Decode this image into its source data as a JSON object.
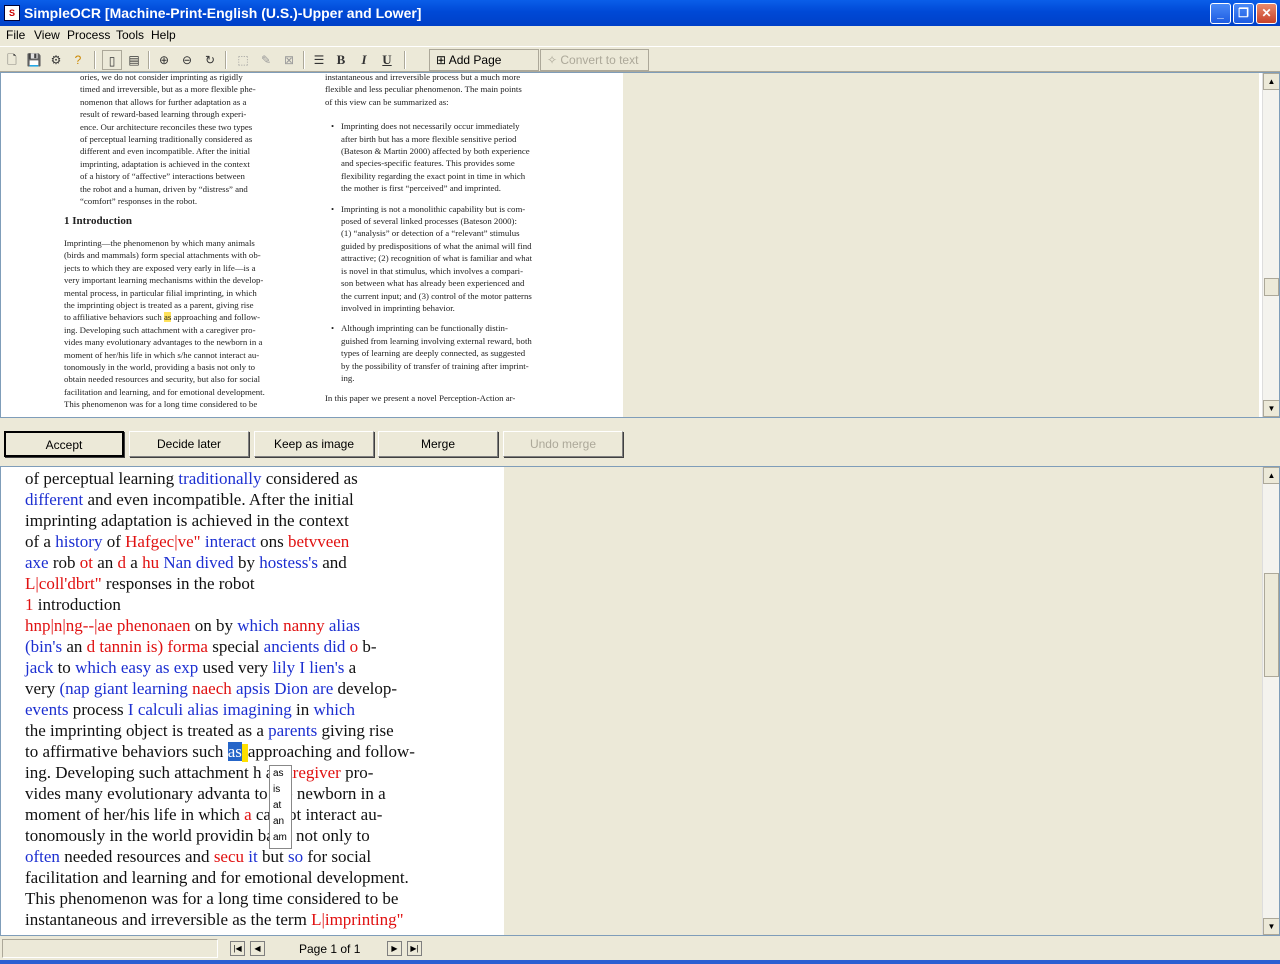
{
  "window": {
    "title": "SimpleOCR [Machine-Print-English (U.S.)-Upper and Lower]",
    "app_icon": "ocr-app-icon"
  },
  "menu": [
    "File",
    "View",
    "Process",
    "Tools",
    "Help"
  ],
  "toolbar": {
    "add_page": "Add Page",
    "convert_to_text": "Convert to text",
    "bold": "B",
    "italic": "I",
    "underline": "U"
  },
  "image_pane": {
    "col1_abstract": [
      "ories, we do not consider imprinting as rigidly",
      "timed and irreversible, but as a more flexible phe-",
      "nomenon that allows for further adaptation as a",
      "result of reward-based learning through experi-",
      "ence. Our architecture reconciles these two types",
      "of perceptual learning traditionally considered as",
      "different and even incompatible. After the initial",
      "imprinting, adaptation is achieved in the context",
      "of a history of “affective” interactions between",
      "the robot and a human, driven by “distress” and",
      "“comfort” responses in the robot."
    ],
    "intro_heading": "1   Introduction",
    "col1_intro": [
      "Imprinting—the phenomenon by which many animals",
      "(birds and mammals) form special attachments with ob-",
      "jects to which they are exposed very early in life—is a",
      "very important learning mechanisms within the develop-",
      "mental process, in particular filial imprinting, in which",
      "the imprinting object is treated as a parent, giving rise",
      "to affiliative behaviors such ",
      "ing. Developing such attachment with a caregiver pro-",
      "vides many evolutionary advantages to the newborn in a",
      "moment of her/his life in which s/he cannot interact au-",
      "tonomously in the world, providing a basis not only to",
      "obtain needed resources and security, but also for social",
      "facilitation and learning, and for emotional development.",
      "  This phenomenon was for a long time considered to be"
    ],
    "highlight_word": "as",
    "highlight_after": " approaching and follow-",
    "col2_top": [
      "instantaneous and irreversible process but a much more",
      "flexible and less peculiar phenomenon. The main points",
      "of this view can be summarized as:"
    ],
    "bullets": [
      [
        "Imprinting does not necessarily occur immediately",
        "after birth but has a more flexible sensitive period",
        "(Bateson & Martin 2000) affected by both experience",
        "and species-specific features.  This provides some",
        "flexibility regarding the exact point in time in which",
        "the mother is first “perceived” and imprinted."
      ],
      [
        "Imprinting is not a monolithic capability but is com-",
        "posed of several linked processes (Bateson 2000):",
        "(1) “analysis” or detection of a “relevant” stimulus",
        "guided by predispositions of what the animal will find",
        "attractive; (2) recognition of what is familiar and what",
        "is novel in that stimulus, which involves a compari-",
        "son between what has already been experienced and",
        "the current input; and (3) control of the motor patterns",
        "involved in imprinting behavior."
      ],
      [
        "Although imprinting can be functionally distin-",
        "guished from learning involving external reward, both",
        "types of learning are deeply connected, as suggested",
        "by the possibility of transfer of training after imprint-",
        "ing."
      ]
    ],
    "col2_last": "  In this paper we present a novel Perception-Action ar-"
  },
  "actions": {
    "accept": "Accept",
    "decide_later": "Decide later",
    "keep_as_image": "Keep as image",
    "merge": "Merge",
    "undo_merge": "Undo merge"
  },
  "ocr_lines": [
    [
      [
        "of perceptual learning ",
        "n"
      ],
      [
        "traditionally",
        "b"
      ],
      [
        " considered as",
        "n"
      ]
    ],
    [
      [
        "different",
        "b"
      ],
      [
        " and even incompatible. After the initial",
        "n"
      ]
    ],
    [
      [
        "imprinting adaptation is achieved in the context",
        "n"
      ]
    ],
    [
      [
        "of a ",
        "n"
      ],
      [
        "history",
        "b"
      ],
      [
        " of ",
        "n"
      ],
      [
        "Hafgec|ve\"",
        "r"
      ],
      [
        " ",
        "n"
      ],
      [
        "interact",
        "b"
      ],
      [
        " ons ",
        "n"
      ],
      [
        "betvveen",
        "r"
      ]
    ],
    [
      [
        "axe",
        "b"
      ],
      [
        " rob ",
        "n"
      ],
      [
        "ot",
        "r"
      ],
      [
        " an ",
        "n"
      ],
      [
        "d",
        "r"
      ],
      [
        " a ",
        "n"
      ],
      [
        "hu",
        "r"
      ],
      [
        " ",
        "n"
      ],
      [
        "Nan dived",
        "b"
      ],
      [
        " by ",
        "n"
      ],
      [
        "hostess's",
        "b"
      ],
      [
        " and",
        "n"
      ]
    ],
    [
      [
        "L|coll'dbrt\"",
        "r"
      ],
      [
        " responses in the robot",
        "n"
      ]
    ],
    [
      [
        "1",
        "r"
      ],
      [
        " introduction",
        "n"
      ]
    ],
    [
      [
        "hnp|n|ng--|ae phenonaen",
        "r"
      ],
      [
        " on by ",
        "n"
      ],
      [
        "which",
        "b"
      ],
      [
        " ",
        "n"
      ],
      [
        "nanny",
        "r"
      ],
      [
        " ",
        "n"
      ],
      [
        "alias",
        "b"
      ]
    ],
    [
      [
        "(bin's",
        "b"
      ],
      [
        " an ",
        "n"
      ],
      [
        "d tannin is)",
        "r"
      ],
      [
        " ",
        "n"
      ],
      [
        "forma",
        "r"
      ],
      [
        " special ",
        "n"
      ],
      [
        "ancients did",
        "b"
      ],
      [
        " ",
        "n"
      ],
      [
        "o",
        "r"
      ],
      [
        " b-",
        "n"
      ]
    ],
    [
      [
        "jack",
        "b"
      ],
      [
        " to ",
        "n"
      ],
      [
        "which easy as exp",
        "b"
      ],
      [
        " used very ",
        "n"
      ],
      [
        "lily I lien's",
        "b"
      ],
      [
        " a",
        "n"
      ]
    ],
    [
      [
        "very ",
        "n"
      ],
      [
        "(nap giant learning",
        "b"
      ],
      [
        " ",
        "n"
      ],
      [
        "naech",
        "r"
      ],
      [
        " ",
        "n"
      ],
      [
        "apsis Dion are",
        "b"
      ],
      [
        " develop-",
        "n"
      ]
    ],
    [
      [
        "events",
        "b"
      ],
      [
        " process ",
        "n"
      ],
      [
        "I calculi alias imagining",
        "b"
      ],
      [
        " in ",
        "n"
      ],
      [
        "which",
        "b"
      ]
    ],
    [
      [
        "the imprinting object is treated as a ",
        "n"
      ],
      [
        "parents",
        "b"
      ],
      [
        " giving rise",
        "n"
      ]
    ],
    [
      [
        "to affirmative behaviors such ",
        "n"
      ],
      [
        "as",
        "s"
      ],
      [
        "",
        "c"
      ],
      [
        "approaching and follow-",
        "n"
      ]
    ],
    [
      [
        "ing. Developing such attachment ",
        "n"
      ],
      [
        "    ",
        "n"
      ],
      [
        "h a ",
        "n"
      ],
      [
        "caregiver",
        "r"
      ],
      [
        " pro-",
        "n"
      ]
    ],
    [
      [
        "vides many evolutionary advanta",
        "n"
      ],
      [
        "      ",
        "n"
      ],
      [
        "to the newborn in a",
        "n"
      ]
    ],
    [
      [
        "moment of her/his life in which ",
        "n"
      ],
      [
        "a",
        "r"
      ],
      [
        "      cannot interact au-",
        "n"
      ]
    ],
    [
      [
        "tonomously in the world providin",
        "n"
      ],
      [
        "      ",
        "n"
      ],
      [
        "basis not only to",
        "n"
      ]
    ],
    [
      [
        "often",
        "b"
      ],
      [
        " needed resources and ",
        "n"
      ],
      [
        "secu",
        "r"
      ],
      [
        " ",
        "n"
      ],
      [
        "it",
        "b"
      ],
      [
        " but ",
        "n"
      ],
      [
        "so",
        "b"
      ],
      [
        " for social",
        "n"
      ]
    ],
    [
      [
        "facilitation and learning and for emotional development.",
        "n"
      ]
    ],
    [
      [
        "This phenomenon was for a long time considered to be",
        "n"
      ]
    ],
    [
      [
        "instantaneous and irreversible as the term ",
        "n"
      ],
      [
        "L|imprinting\"",
        "r"
      ]
    ]
  ],
  "suggestions": [
    "as",
    "is",
    "at",
    "an",
    "am"
  ],
  "status": {
    "page_label": "Page 1 of 1"
  },
  "colors": {
    "suspect_word": "#e01010",
    "dictionary_word": "#1c2fd1",
    "selection": "#2565c8"
  }
}
